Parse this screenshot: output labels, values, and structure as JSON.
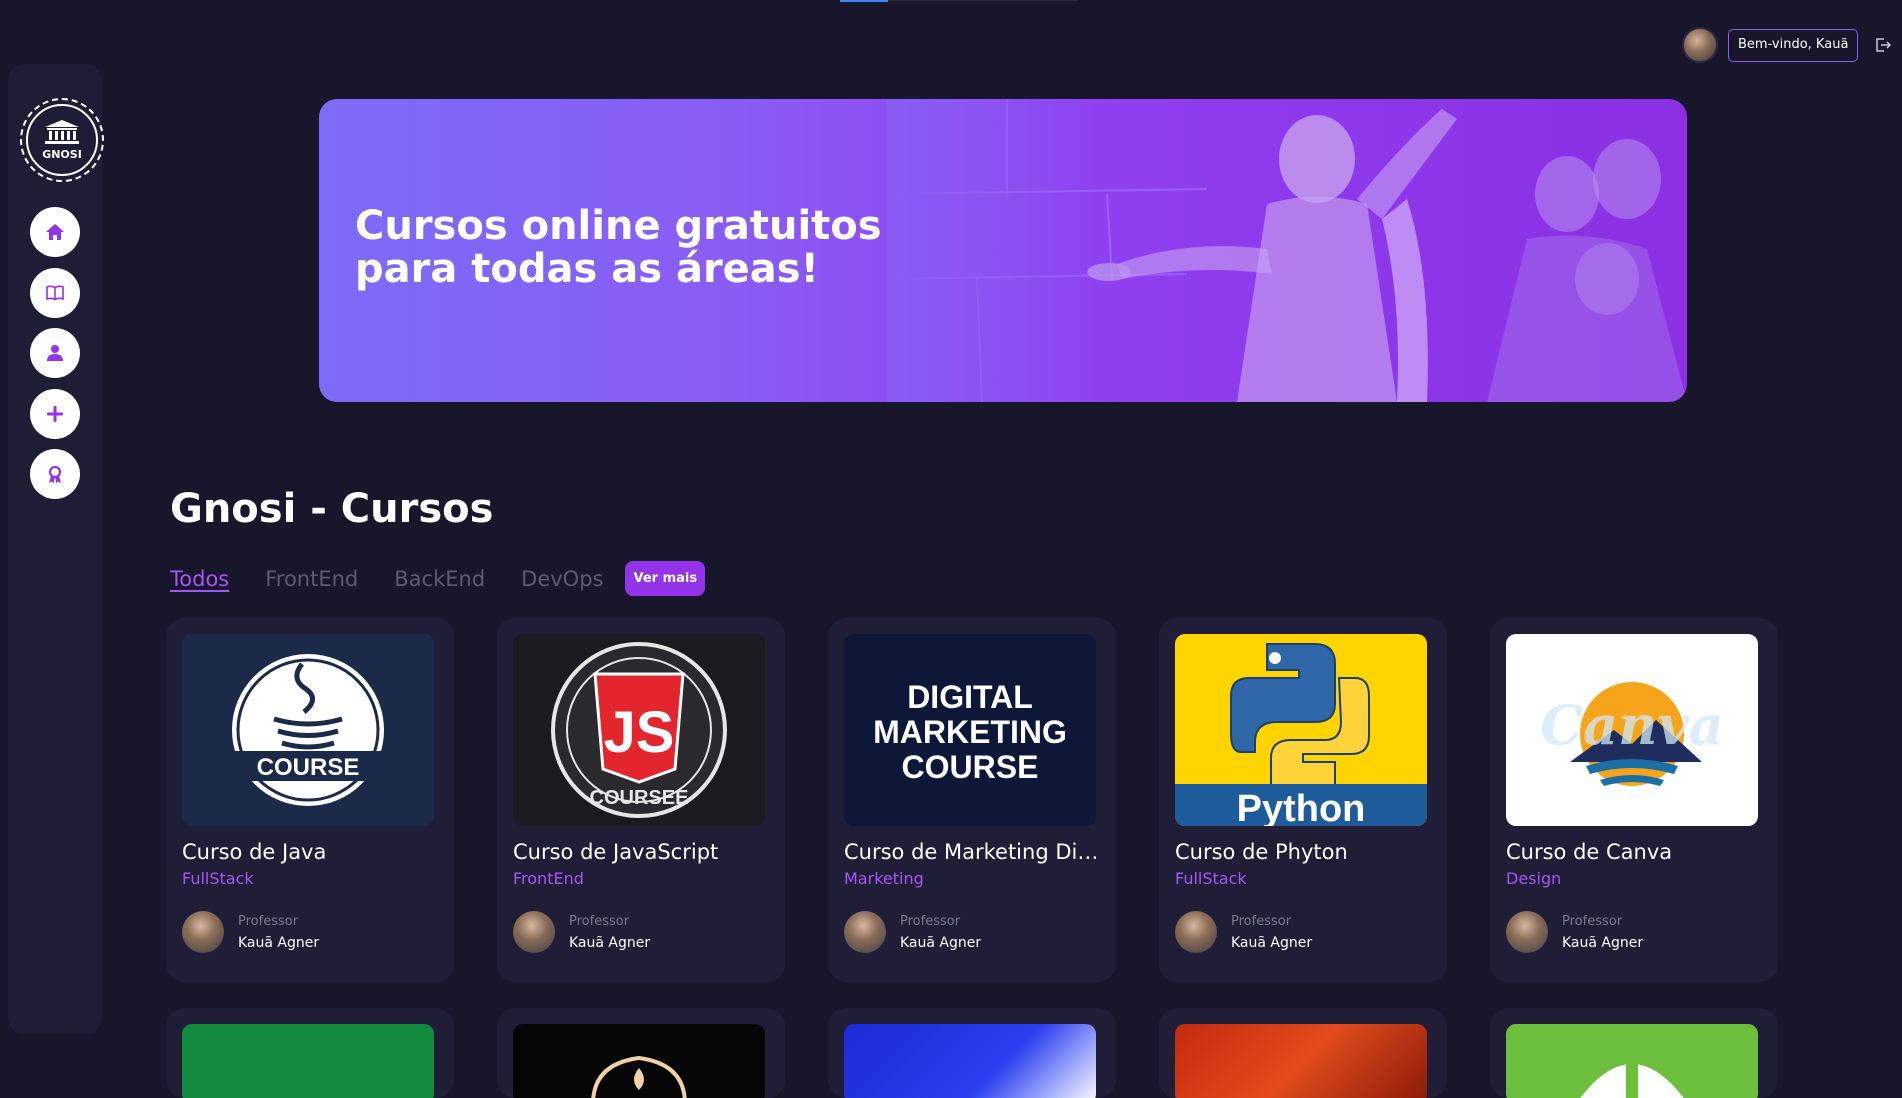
{
  "header": {
    "welcome_label": "Bem-vindo, Kauã"
  },
  "sidebar": {
    "logo_text": "GNOSI",
    "items": [
      {
        "name": "home",
        "icon": "home-icon"
      },
      {
        "name": "courses",
        "icon": "book-icon"
      },
      {
        "name": "profile",
        "icon": "user-icon"
      },
      {
        "name": "add",
        "icon": "plus-icon"
      },
      {
        "name": "certificates",
        "icon": "award-icon"
      }
    ]
  },
  "banner": {
    "title": "Cursos online gratuitos\npara todas as áreas!"
  },
  "section": {
    "title": "Gnosi - Cursos",
    "tabs": [
      {
        "label": "Todos",
        "active": true
      },
      {
        "label": "FrontEnd",
        "active": false
      },
      {
        "label": "BackEnd",
        "active": false
      },
      {
        "label": "DevOps",
        "active": false
      }
    ],
    "more_label": "Ver mais"
  },
  "courses": [
    {
      "title": "Curso de Java",
      "category": "FullStack",
      "professor_label": "Professor",
      "professor": "Kauã Agner",
      "thumb_text": "COURSE"
    },
    {
      "title": "Curso de JavaScript",
      "category": "FrontEnd",
      "professor_label": "Professor",
      "professor": "Kauã Agner",
      "thumb_text": "COURSEE"
    },
    {
      "title": "Curso de Marketing Digi...",
      "category": "Marketing",
      "professor_label": "Professor",
      "professor": "Kauã Agner",
      "thumb_text": "DIGITAL MARKETING COURSE"
    },
    {
      "title": "Curso de Phyton",
      "category": "FullStack",
      "professor_label": "Professor",
      "professor": "Kauã Agner",
      "thumb_text": "Python"
    },
    {
      "title": "Curso de Canva",
      "category": "Design",
      "professor_label": "Professor",
      "professor": "Kauã Agner",
      "thumb_text": "Canva"
    }
  ],
  "colors": {
    "background": "#17162b",
    "card": "#1f1e36",
    "accent": "#a855f7",
    "accent_button": "#9333ea"
  }
}
